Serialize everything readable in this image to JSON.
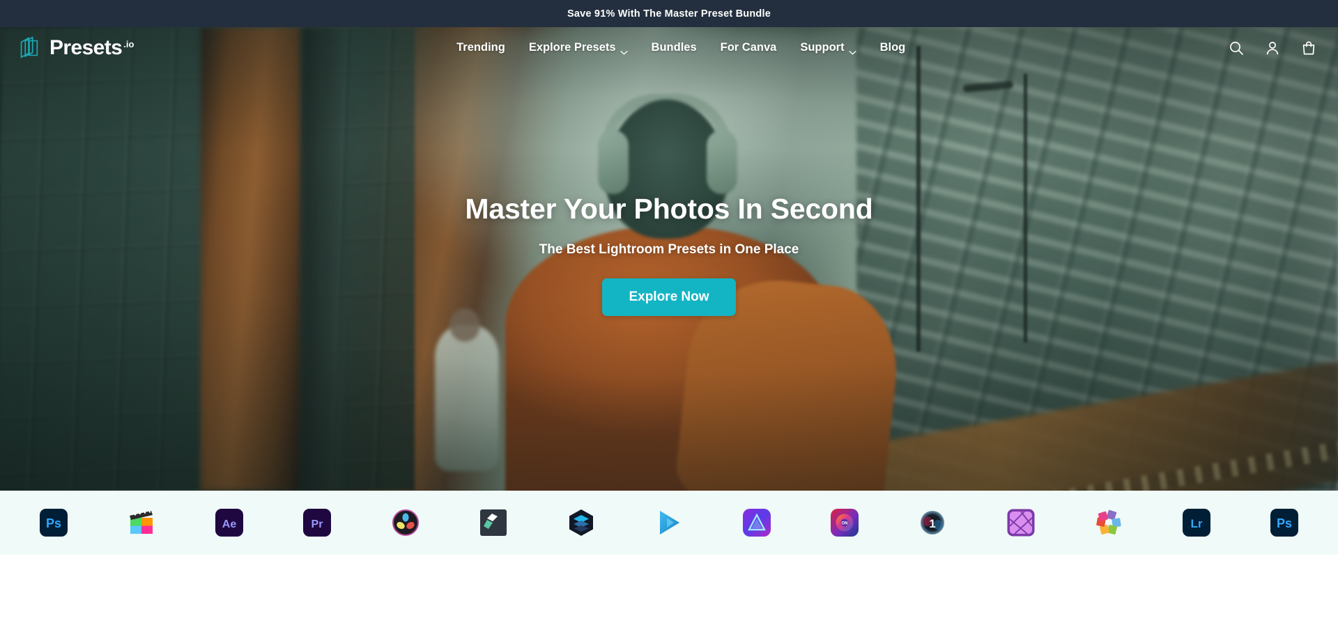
{
  "announcement": {
    "text": "Save 91% With The Master Preset Bundle",
    "background": "#232F3E"
  },
  "header": {
    "brand": {
      "name": "Presets",
      "tld": ".io",
      "logo_icon": "stacked-frames-icon",
      "accent": "#1BA9B5"
    },
    "nav": [
      {
        "label": "Trending",
        "has_dropdown": false
      },
      {
        "label": "Explore Presets",
        "has_dropdown": true
      },
      {
        "label": "Bundles",
        "has_dropdown": false
      },
      {
        "label": "For Canva",
        "has_dropdown": false
      },
      {
        "label": "Support",
        "has_dropdown": true
      },
      {
        "label": "Blog",
        "has_dropdown": false
      }
    ],
    "actions": [
      {
        "name": "search-icon",
        "label": "Search"
      },
      {
        "name": "account-icon",
        "label": "Account"
      },
      {
        "name": "cart-icon",
        "label": "Cart"
      }
    ]
  },
  "hero": {
    "title": "Master Your Photos In Second",
    "subtitle": "The Best Lightroom Presets in One Place",
    "cta_label": "Explore Now",
    "cta_color": "#13B5C4",
    "image_description": "Person seen from behind wearing headphones and an orange jacket with backpack, walking through a teal-graded city street"
  },
  "app_strip": {
    "background": "#F0FAF8",
    "apps": [
      {
        "name": "photoshop",
        "label": "Ps",
        "style": "adobe",
        "bg": "#001E36",
        "fg": "#31A8FF"
      },
      {
        "name": "final-cut-pro",
        "label": "",
        "style": "finalcut"
      },
      {
        "name": "after-effects",
        "label": "Ae",
        "style": "adobe",
        "bg": "#1F0740",
        "fg": "#9999FF"
      },
      {
        "name": "premiere-pro",
        "label": "Pr",
        "style": "adobe",
        "bg": "#1F0740",
        "fg": "#9999FF"
      },
      {
        "name": "davinci-resolve",
        "label": "",
        "style": "davinci"
      },
      {
        "name": "filmora",
        "label": "",
        "style": "filmora"
      },
      {
        "name": "capture-one-hex",
        "label": "",
        "style": "hexlayers"
      },
      {
        "name": "powerdirector",
        "label": "",
        "style": "playtriangle"
      },
      {
        "name": "luminar",
        "label": "",
        "style": "luminar"
      },
      {
        "name": "on1-photo-raw",
        "label": "ON",
        "style": "on1"
      },
      {
        "name": "capture-one",
        "label": "1",
        "style": "captureone"
      },
      {
        "name": "affinity-photo",
        "label": "",
        "style": "affinity"
      },
      {
        "name": "corel-pinwheel",
        "label": "",
        "style": "pinwheel"
      },
      {
        "name": "lightroom",
        "label": "Lr",
        "style": "adobe",
        "bg": "#001E36",
        "fg": "#31A8FF"
      },
      {
        "name": "photoshop-2",
        "label": "Ps",
        "style": "adobe",
        "bg": "#001E36",
        "fg": "#31A8FF"
      }
    ]
  }
}
